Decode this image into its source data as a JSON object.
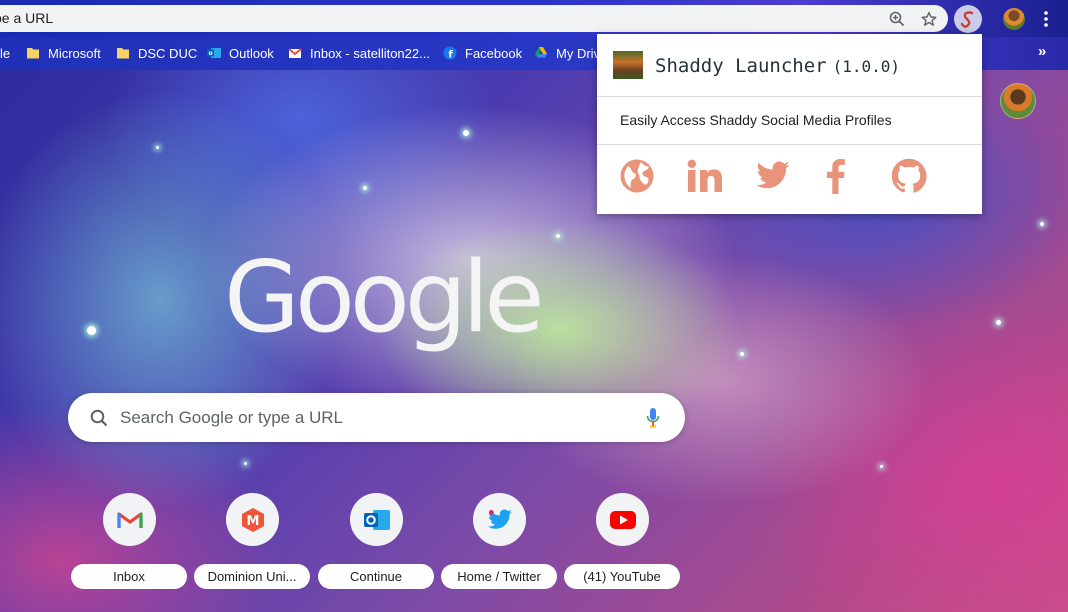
{
  "browser": {
    "url_text": "pe a URL",
    "accent": "#e8937a"
  },
  "bookmarks": [
    {
      "label": "le",
      "icon": "folder-icon"
    },
    {
      "label": "Microsoft",
      "icon": "folder-icon"
    },
    {
      "label": "DSC DUC",
      "icon": "folder-icon"
    },
    {
      "label": "Outlook",
      "icon": "outlook-icon"
    },
    {
      "label": "Inbox - satelliton22...",
      "icon": "gmail-icon"
    },
    {
      "label": "Facebook",
      "icon": "facebook-icon"
    },
    {
      "label": "My Driv",
      "icon": "drive-icon"
    }
  ],
  "bookmarks_more": "»",
  "popup": {
    "title": "Shaddy Launcher",
    "version": "(1.0.0)",
    "description": "Easily Access Shaddy Social Media Profiles",
    "links": [
      {
        "name": "website",
        "icon": "globe-icon"
      },
      {
        "name": "linkedin",
        "icon": "linkedin-icon"
      },
      {
        "name": "twitter",
        "icon": "twitter-icon"
      },
      {
        "name": "facebook",
        "icon": "facebook-icon"
      },
      {
        "name": "github",
        "icon": "github-icon"
      }
    ],
    "icon_color": "#e8937a"
  },
  "page": {
    "logo_text": "Google",
    "search_placeholder": "Search Google or type a URL"
  },
  "shortcuts": [
    {
      "label": "Inbox",
      "icon": "gmail-icon"
    },
    {
      "label": "Dominion Uni...",
      "icon": "mymemo-icon"
    },
    {
      "label": "Continue",
      "icon": "outlook-icon"
    },
    {
      "label": "Home / Twitter",
      "icon": "twitter-icon"
    },
    {
      "label": "(41) YouTube",
      "icon": "youtube-icon"
    }
  ]
}
